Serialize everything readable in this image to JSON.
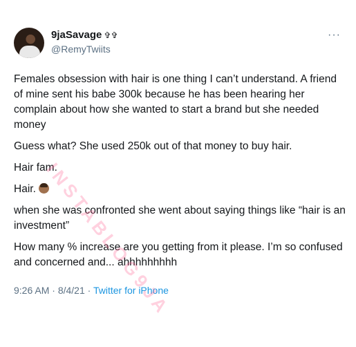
{
  "user": {
    "display_name": "9jaSavage",
    "name_badge": "✞✞",
    "handle": "@RemyTwiits"
  },
  "tweet": {
    "paragraphs": [
      "Females obsession with hair is one thing I can’t understand. A friend of mine sent his babe 300k because he has been hearing her complain about how she wanted to start a brand but she needed money",
      "Guess what? She used 250k out of that money to buy hair.",
      "Hair fam.",
      "Hair.",
      "when she was confronted she went about saying things like “hair is an investment”",
      "How many % increase are you getting from it please. I’m so confused and concerned and... ahhhhhhhhh"
    ],
    "time": "9:26 AM",
    "date": "8/4/21",
    "separator": "·",
    "source": "Twitter for iPhone"
  },
  "more_icon": "more-options-icon",
  "watermark": "INSTABLOG9JA",
  "colors": {
    "link": "#1b95e0",
    "secondary": "#5b7083",
    "text": "#14171a"
  }
}
